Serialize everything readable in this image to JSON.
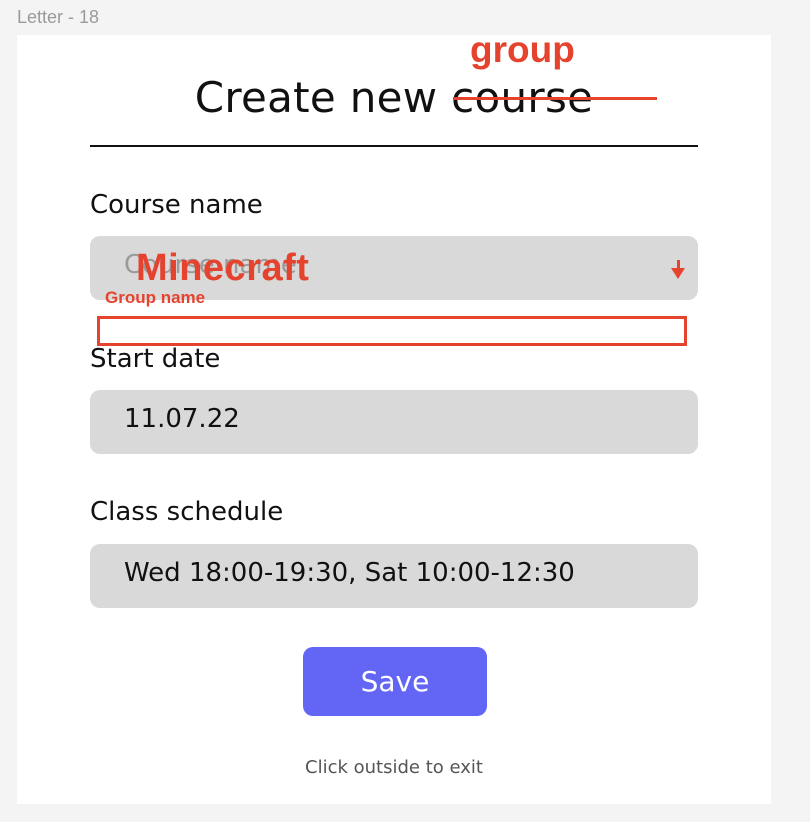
{
  "frame_label": "Letter - 18",
  "title": {
    "prefix": "Create new ",
    "struck_word": "course"
  },
  "fields": {
    "course_name": {
      "label": "Course name",
      "placeholder": "Course name"
    },
    "start_date": {
      "label": "Start date",
      "value": "11.07.22"
    },
    "class_schedule": {
      "label": "Class schedule",
      "value": "Wed 18:00-19:30, Sat 10:00-12:30"
    }
  },
  "save_button": {
    "label": "Save"
  },
  "hint": "Click outside to exit",
  "annotations": {
    "group": "group",
    "minecraft": "Minecraft",
    "group_name": "Group name"
  },
  "colors": {
    "accent": "#6366f5",
    "annotation": "#e5432e",
    "field_bg": "#d9d9d9"
  }
}
